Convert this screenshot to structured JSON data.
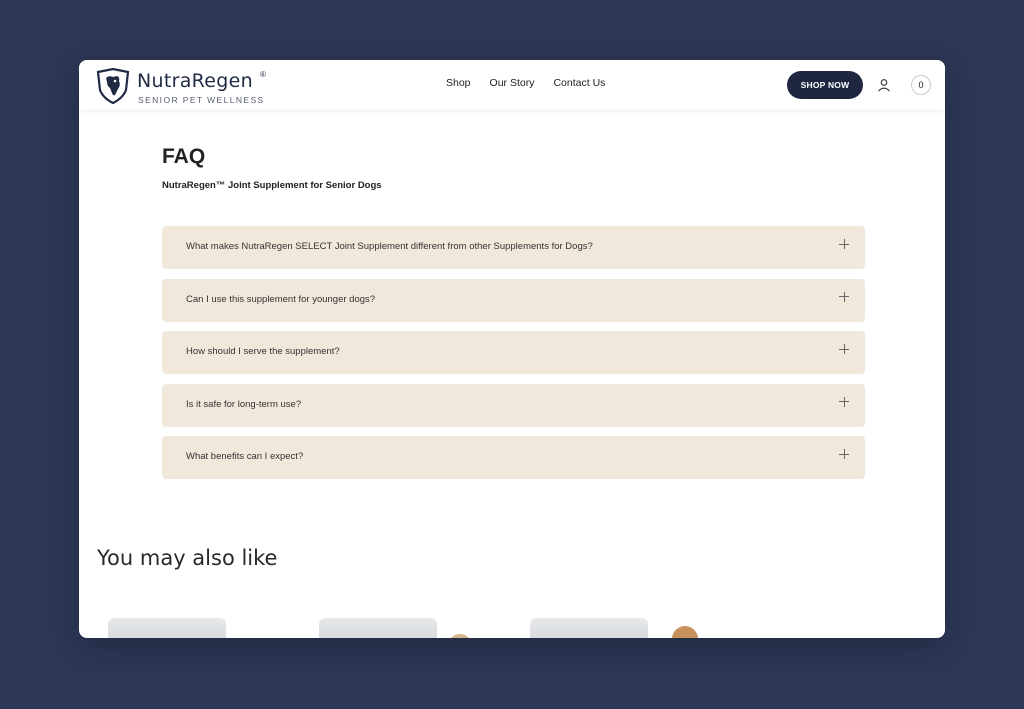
{
  "brand": {
    "name": "NutraRegen",
    "reg": "®",
    "tagline": "SENIOR PET WELLNESS"
  },
  "nav": {
    "items": [
      "Shop",
      "Our Story",
      "Contact Us"
    ],
    "shop_now": "SHOP NOW",
    "cart_count": "0"
  },
  "faq": {
    "title": "FAQ",
    "subtitle": "NutraRegen™ Joint Supplement for Senior Dogs",
    "questions": [
      "What makes NutraRegen SELECT Joint Supplement different from other Supplements for Dogs?",
      "Can I use this supplement for younger dogs?",
      "How should I serve the supplement?",
      "Is it safe for long-term use?",
      "What benefits can I expect?"
    ]
  },
  "recommendations": {
    "heading": "You may also like"
  },
  "colors": {
    "page_bg": "#2d3756",
    "accent": "#1f2640",
    "faq_item_bg": "#f1e8dc"
  },
  "icons": {
    "logo": "dog-shield-icon",
    "account": "user-icon",
    "expand": "plus-icon"
  }
}
